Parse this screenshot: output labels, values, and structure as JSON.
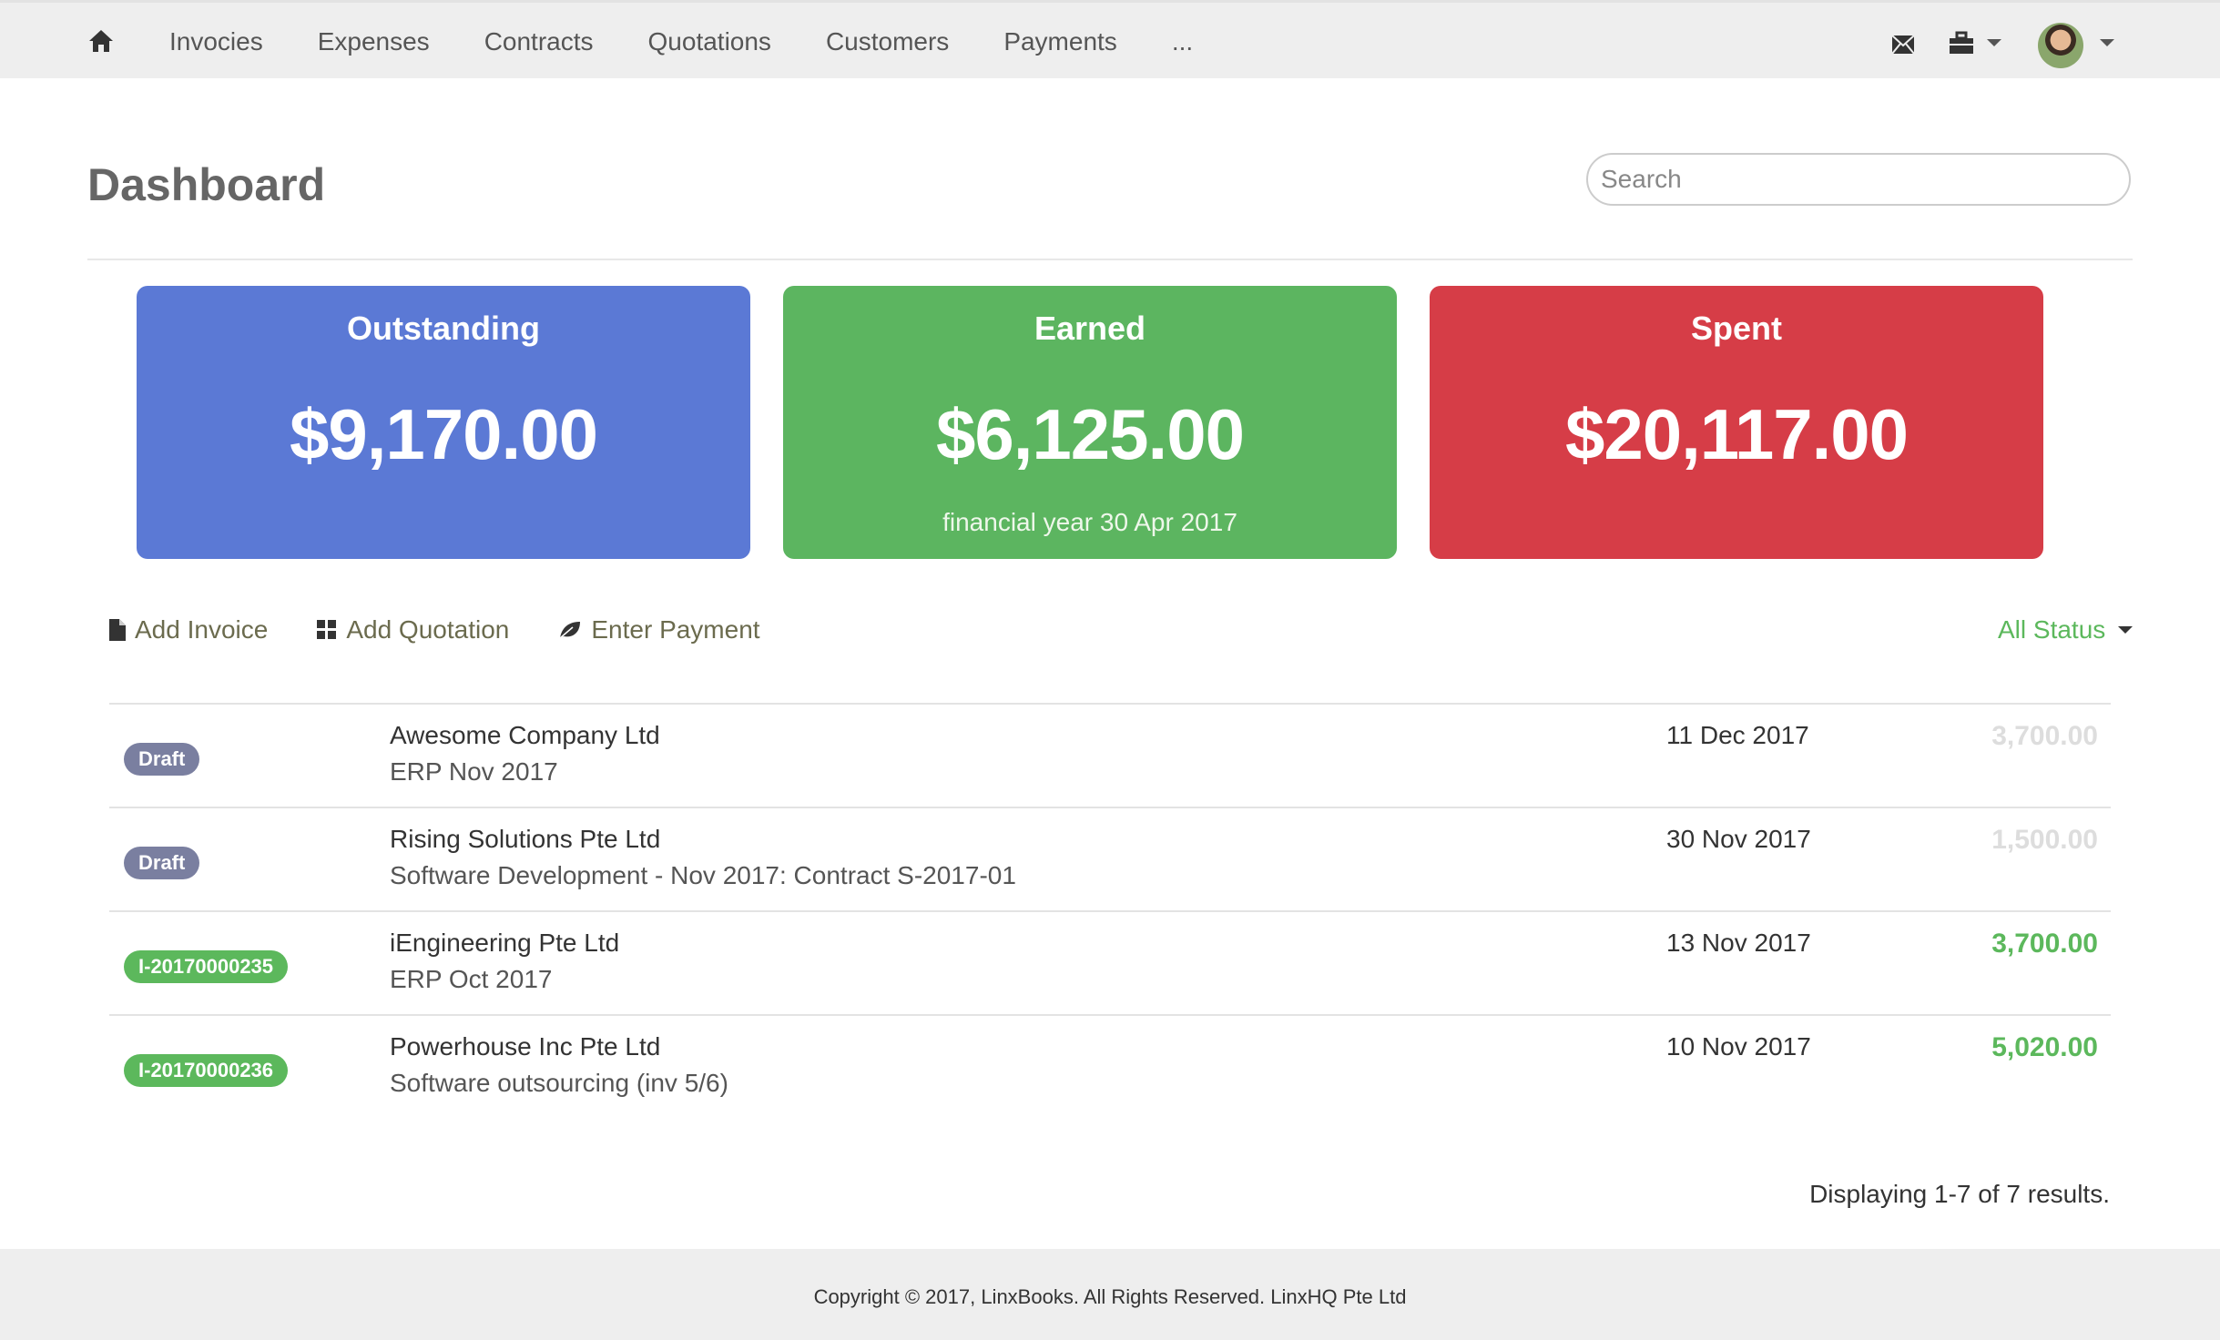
{
  "nav": {
    "home_icon": "home-icon",
    "items": [
      "Invocies",
      "Expenses",
      "Contracts",
      "Quotations",
      "Customers",
      "Payments",
      "..."
    ],
    "icons": [
      "mail-icon",
      "briefcase-icon",
      "avatar"
    ]
  },
  "header": {
    "title": "Dashboard",
    "search_placeholder": "Search"
  },
  "cards": [
    {
      "title": "Outstanding",
      "amount": "$9,170.00",
      "sub": "",
      "color": "#5b79d5"
    },
    {
      "title": "Earned",
      "amount": "$6,125.00",
      "sub": "financial year 30 Apr 2017",
      "color": "#5cb560"
    },
    {
      "title": "Spent",
      "amount": "$20,117.00",
      "sub": "",
      "color": "#d63d47"
    }
  ],
  "actions": {
    "add_invoice": "Add Invoice",
    "add_quotation": "Add Quotation",
    "enter_payment": "Enter Payment",
    "status_filter": "All Status"
  },
  "rows": [
    {
      "badge": "Draft",
      "badge_color": "#7a7fa0",
      "customer": "Awesome Company Ltd",
      "desc": "ERP Nov 2017",
      "date": "11 Dec 2017",
      "amount": "3,700.00",
      "amount_color": "#dddddd"
    },
    {
      "badge": "Draft",
      "badge_color": "#7a7fa0",
      "customer": "Rising Solutions Pte Ltd",
      "desc": "Software Development - Nov 2017: Contract S-2017-01",
      "date": "30 Nov 2017",
      "amount": "1,500.00",
      "amount_color": "#dddddd"
    },
    {
      "badge": "I-20170000235",
      "badge_color": "#5cb85c",
      "customer": "iEngineering Pte Ltd",
      "desc": "ERP Oct 2017",
      "date": "13 Nov 2017",
      "amount": "3,700.00",
      "amount_color": "#5cb85c"
    },
    {
      "badge": "I-20170000236",
      "badge_color": "#5cb85c",
      "customer": "Powerhouse Inc Pte Ltd",
      "desc": "Software outsourcing (inv 5/6)",
      "date": "10 Nov 2017",
      "amount": "5,020.00",
      "amount_color": "#5cb85c"
    }
  ],
  "results": "Displaying 1-7 of 7 results.",
  "footer": "Copyright © 2017, LinxBooks. All Rights Reserved. LinxHQ Pte Ltd"
}
